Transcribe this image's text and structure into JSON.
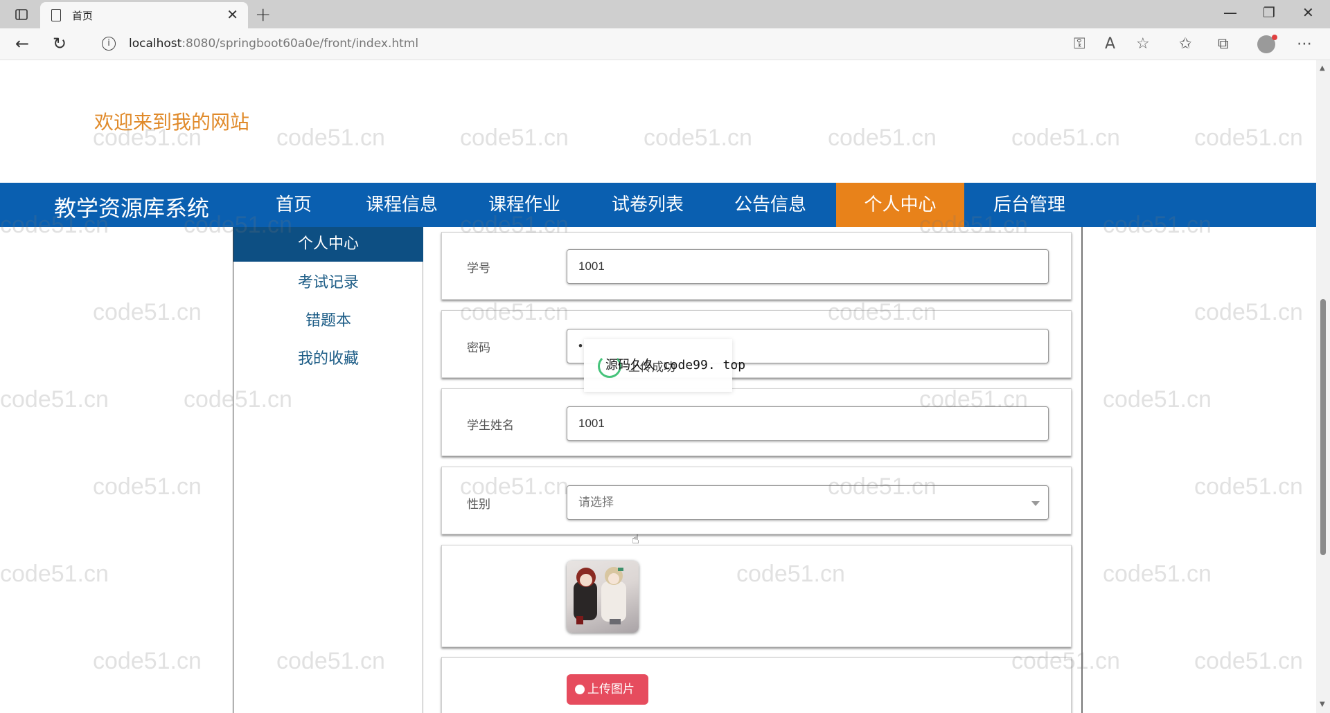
{
  "browser": {
    "tab_title": "首页",
    "new_tab_label": "+",
    "url_host": "localhost",
    "url_rest": ":8080/springboot60a0e/front/index.html"
  },
  "site": {
    "welcome": "欢迎来到我的网站",
    "title": "教学资源库系统",
    "nav": [
      "首页",
      "课程信息",
      "课程作业",
      "试卷列表",
      "公告信息",
      "个人中心",
      "后台管理"
    ],
    "active_nav": "个人中心"
  },
  "sidebar": {
    "items": [
      "个人中心",
      "考试记录",
      "错题本",
      "我的收藏"
    ]
  },
  "form": {
    "student_no_label": "学号",
    "student_no_value": "1001",
    "password_label": "密码",
    "password_value": "•",
    "name_label": "学生姓名",
    "name_value": "1001",
    "gender_label": "性别",
    "gender_placeholder": "请选择",
    "upload_label": "上传图片"
  },
  "toast": {
    "message": "上传成功",
    "overlay_text": "源码久久 code99. top"
  },
  "watermark": "code51.cn",
  "colors": {
    "nav_bg": "#0a5fb0",
    "nav_active": "#e8821a",
    "sidebar_active": "#0d4f83",
    "welcome": "#e08a2a",
    "upload_button": "#e64c5e"
  }
}
